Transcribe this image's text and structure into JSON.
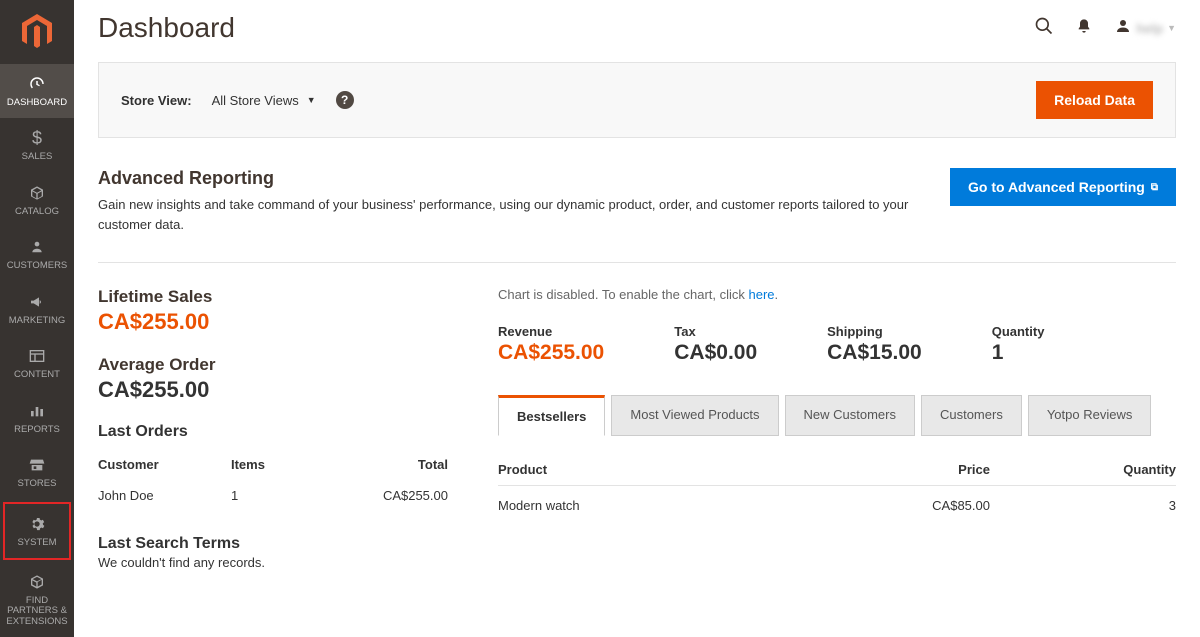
{
  "sidebar": {
    "items": [
      {
        "label": "DASHBOARD",
        "icon": "dashboard"
      },
      {
        "label": "SALES",
        "icon": "dollar"
      },
      {
        "label": "CATALOG",
        "icon": "cube"
      },
      {
        "label": "CUSTOMERS",
        "icon": "person"
      },
      {
        "label": "MARKETING",
        "icon": "megaphone"
      },
      {
        "label": "CONTENT",
        "icon": "layout"
      },
      {
        "label": "REPORTS",
        "icon": "bars"
      },
      {
        "label": "STORES",
        "icon": "storefront"
      },
      {
        "label": "SYSTEM",
        "icon": "gear"
      },
      {
        "label": "FIND PARTNERS & EXTENSIONS",
        "icon": "package"
      }
    ]
  },
  "header": {
    "title": "Dashboard",
    "user_name": "help"
  },
  "store_bar": {
    "label": "Store View:",
    "selected": "All Store Views",
    "reload_btn": "Reload Data"
  },
  "advanced_reporting": {
    "title": "Advanced Reporting",
    "desc": "Gain new insights and take command of your business' performance, using our dynamic product, order, and customer reports tailored to your customer data.",
    "btn": "Go to Advanced Reporting"
  },
  "lifetime_sales": {
    "label": "Lifetime Sales",
    "value": "CA$255.00"
  },
  "average_order": {
    "label": "Average Order",
    "value": "CA$255.00"
  },
  "last_orders": {
    "title": "Last Orders",
    "headers": {
      "customer": "Customer",
      "items": "Items",
      "total": "Total"
    },
    "rows": [
      {
        "customer": "John Doe",
        "items": "1",
        "total": "CA$255.00"
      }
    ]
  },
  "last_search": {
    "title": "Last Search Terms",
    "empty": "We couldn't find any records."
  },
  "chart_note": {
    "prefix": "Chart is disabled. To enable the chart, click ",
    "link": "here"
  },
  "metrics": {
    "revenue": {
      "label": "Revenue",
      "value": "CA$255.00"
    },
    "tax": {
      "label": "Tax",
      "value": "CA$0.00"
    },
    "shipping": {
      "label": "Shipping",
      "value": "CA$15.00"
    },
    "quantity": {
      "label": "Quantity",
      "value": "1"
    }
  },
  "tabs": {
    "labels": [
      "Bestsellers",
      "Most Viewed Products",
      "New Customers",
      "Customers",
      "Yotpo Reviews"
    ],
    "active": 0
  },
  "bestsellers": {
    "headers": {
      "product": "Product",
      "price": "Price",
      "quantity": "Quantity"
    },
    "rows": [
      {
        "product": "Modern watch",
        "price": "CA$85.00",
        "quantity": "3"
      }
    ]
  }
}
